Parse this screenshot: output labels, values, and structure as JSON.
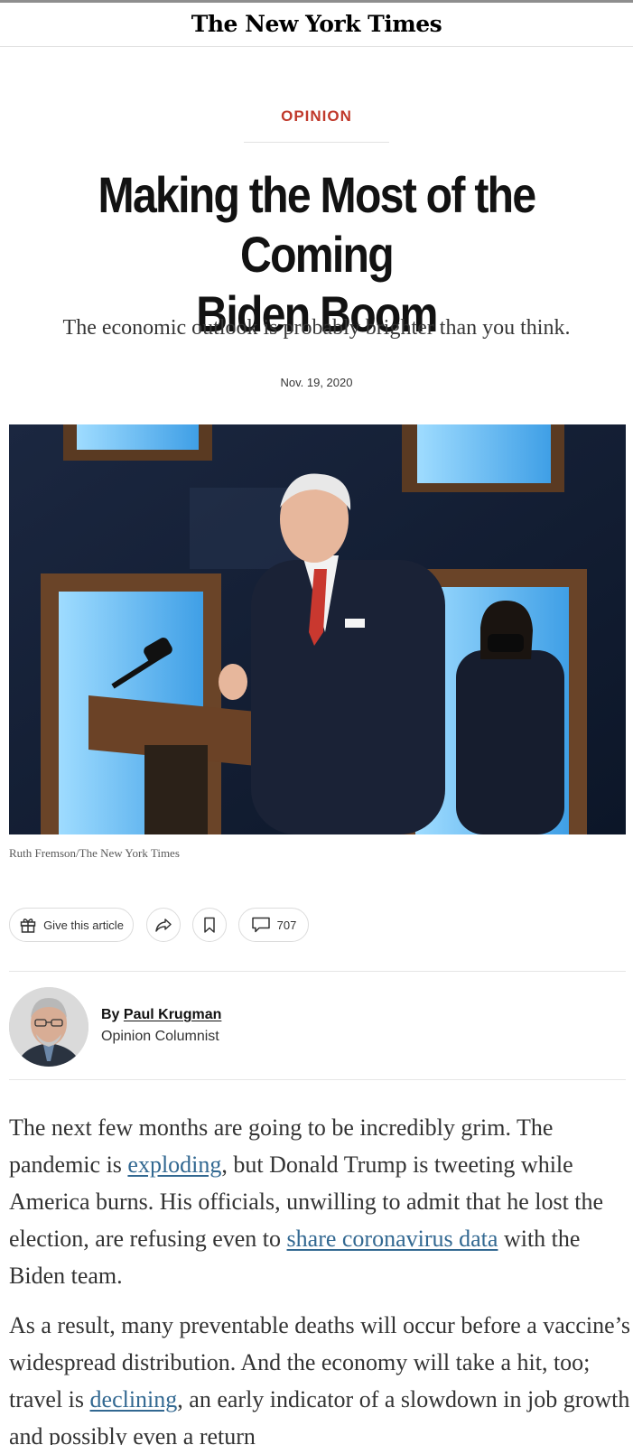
{
  "masthead": {
    "title": "The New York Times"
  },
  "article": {
    "kicker": "OPINION",
    "headline_line1": "Making the Most of the Coming",
    "headline_line2": "Biden Boom",
    "dek": "The economic outlook is probably brighter than you think.",
    "date": "Nov. 19, 2020",
    "photo_credit": "Ruth Fremson/The New York Times"
  },
  "tools": {
    "gift_label": "Give this article",
    "comments_count": "707"
  },
  "byline": {
    "by": "By",
    "author": "Paul Krugman",
    "role": "Opinion Columnist"
  },
  "body": {
    "p1_a": "The next few months are going to be incredibly grim. The pandemic is ",
    "p1_link1": "exploding",
    "p1_b": ", but Donald Trump is tweeting while America burns. His officials, unwilling to admit that he lost the election, are refusing even to ",
    "p1_link2": "share coronavirus data",
    "p1_c": " with the Biden team.",
    "p2_a": "As a result, many preventable deaths will occur before a vaccine’s widespread distribution. And the economy will take a hit, too; travel is ",
    "p2_link": "declining",
    "p2_b": ", an early indicator of a slowdown in job growth and possibly even a return"
  },
  "colors": {
    "kicker": "#c0392b",
    "link": "#326891",
    "text": "#333333"
  },
  "icons": [
    "gift-icon",
    "share-icon",
    "bookmark-icon",
    "comment-icon"
  ]
}
